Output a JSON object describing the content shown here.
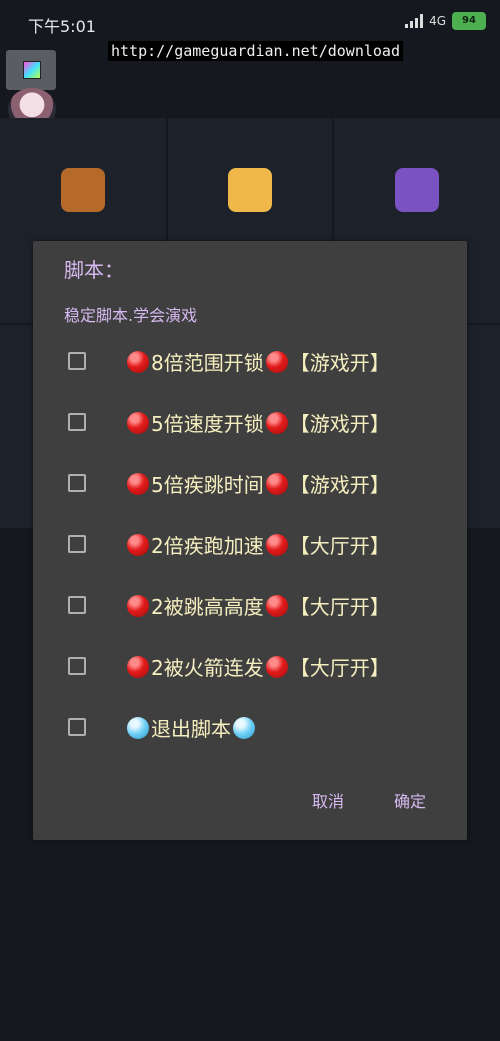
{
  "status_bar": {
    "time": "下午5:01",
    "network": "4G",
    "battery": "94"
  },
  "url": "http://gameguardian.net/download",
  "background_apps": [
    {
      "icon": "game-app-icon",
      "color": "#b66a2a",
      "label": ""
    },
    {
      "icon": "cartoon-app-icon",
      "color": "#f0b84a",
      "label": ""
    },
    {
      "icon": "gg-app-icon",
      "color": "#7b52c2",
      "label": ""
    }
  ],
  "dialog": {
    "title": "脚本：",
    "subtitle": "稳定脚本.学会演戏",
    "options": [
      {
        "text": "8倍范围开锁",
        "tag": "【游戏开】",
        "dot_color": "red",
        "checked": false
      },
      {
        "text": "5倍速度开锁",
        "tag": "【游戏开】",
        "dot_color": "red",
        "checked": false
      },
      {
        "text": "5倍疾跳时间",
        "tag": "【游戏开】",
        "dot_color": "red",
        "checked": false
      },
      {
        "text": "2倍疾跑加速",
        "tag": "【大厅开】",
        "dot_color": "red",
        "checked": false
      },
      {
        "text": "2被跳高高度",
        "tag": "【大厅开】",
        "dot_color": "red",
        "checked": false
      },
      {
        "text": "2被火箭连发",
        "tag": "【大厅开】",
        "dot_color": "red",
        "checked": false
      },
      {
        "text": "退出脚本",
        "tag": "",
        "dot_color": "blue",
        "checked": false
      }
    ],
    "cancel_label": "取消",
    "ok_label": "确定"
  },
  "colors": {
    "dialog_bg": "#3f3f3f",
    "accent_text": "#d6b9f0",
    "option_text": "#f5efc0"
  }
}
